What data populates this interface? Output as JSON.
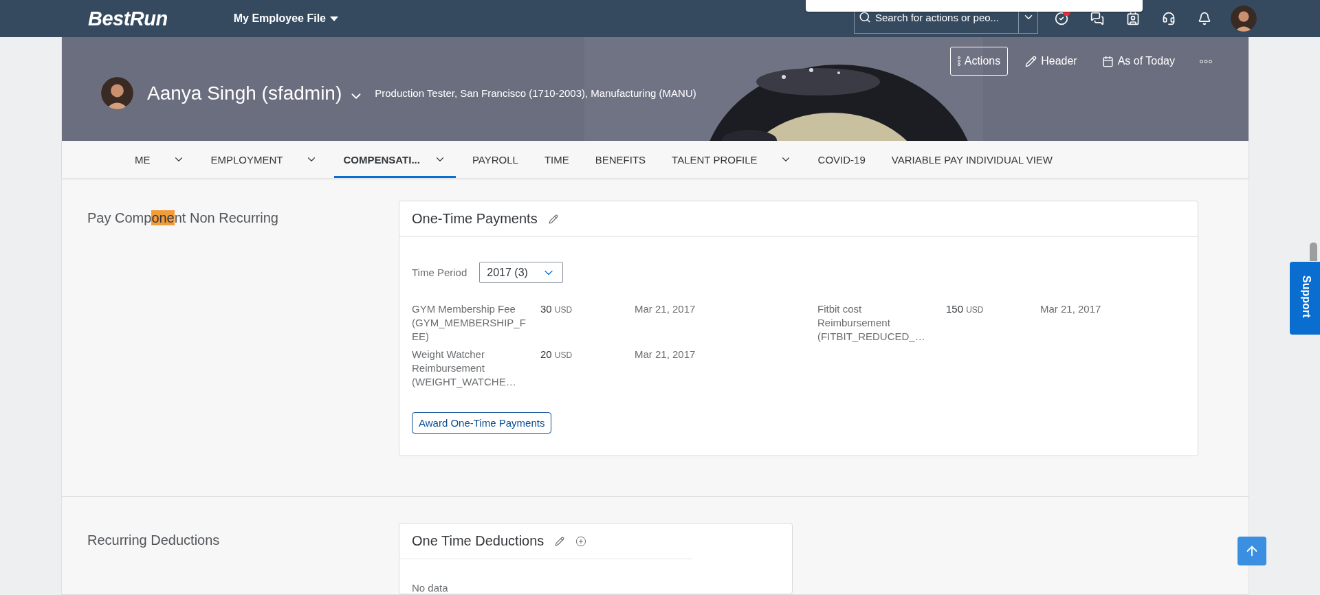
{
  "shell": {
    "logo": "BestRun",
    "menu_title": "My Employee File",
    "search": {
      "placeholder": "Search for actions or peo..."
    }
  },
  "header": {
    "name": "Aanya Singh (sfadmin)",
    "subtitle": "Production Tester, San Francisco (1710-2003), Manufacturing (MANU)",
    "actions": [
      {
        "kind": "actions",
        "label": "Actions"
      },
      {
        "kind": "edit",
        "label": "Header"
      },
      {
        "kind": "calendar",
        "label": "As of Today"
      },
      {
        "kind": "more"
      }
    ]
  },
  "tabs": [
    {
      "label": "ME",
      "selected": false,
      "has_menu": true
    },
    {
      "label": "EMPLOYMENT",
      "selected": false,
      "has_menu": true
    },
    {
      "label": "COMPENSATI...",
      "selected": true,
      "has_menu": true
    },
    {
      "label": "PAYROLL",
      "selected": false,
      "has_menu": false
    },
    {
      "label": "TIME",
      "selected": false,
      "has_menu": false
    },
    {
      "label": "BENEFITS",
      "selected": false,
      "has_menu": false
    },
    {
      "label": "TALENT PROFILE",
      "selected": false,
      "has_menu": true
    },
    {
      "label": "COVID-19",
      "selected": false,
      "has_menu": false
    },
    {
      "label": "VARIABLE PAY INDIVIDUAL VIEW",
      "selected": false,
      "has_menu": false
    }
  ],
  "sections": [
    {
      "label": {
        "before": "Pay Comp",
        "match": "one",
        "after": "nt Non Recurring"
      },
      "card": {
        "title": "One-Time Payments",
        "editable": true,
        "addable": false,
        "time_period": {
          "label": "Time Period",
          "value": "2017 (3)"
        },
        "payments": [
          {
            "name": "GYM Membership Fee (GYM_MEMBERSHIP_FEE)",
            "amount": "30",
            "currency": "USD",
            "date": "Mar 21, 2017"
          },
          {
            "name": "Fitbit cost Reimbursement (FITBIT_REDUCED_…",
            "amount": "150",
            "currency": "USD",
            "date": "Mar 21, 2017"
          },
          {
            "name": "Weight Watcher Reimbursement (WEIGHT_WATCHE…",
            "amount": "20",
            "currency": "USD",
            "date": "Mar 21, 2017"
          }
        ],
        "button": "Award One-Time Payments"
      }
    },
    {
      "label": {
        "before": "Recurring Deductions"
      },
      "card": {
        "title": "One Time Deductions",
        "editable": true,
        "addable": true,
        "empty_text": "No data"
      }
    }
  ],
  "support": "Support"
}
